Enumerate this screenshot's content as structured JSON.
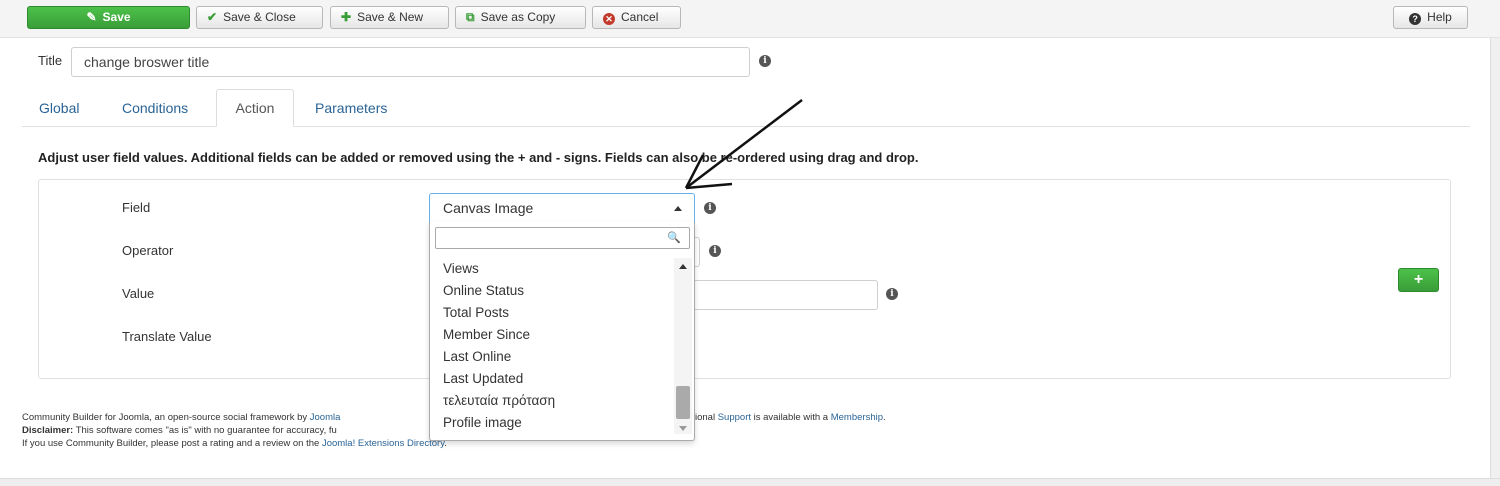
{
  "toolbar": {
    "save": "Save",
    "save_close": "Save & Close",
    "save_new": "Save & New",
    "save_copy": "Save as Copy",
    "cancel": "Cancel",
    "help": "Help"
  },
  "title": {
    "label": "Title",
    "value": "change broswer title"
  },
  "tabs": [
    "Global",
    "Conditions",
    "Action",
    "Parameters"
  ],
  "description": "Adjust user field values. Additional fields can be added or removed using the + and - signs. Fields can also be re-ordered using drag and drop.",
  "form": {
    "field_label": "Field",
    "operator_label": "Operator",
    "value_label": "Value",
    "translate_label": "Translate Value",
    "field_selected": "Canvas Image"
  },
  "dropdown": {
    "items": [
      "Views",
      "Online Status",
      "Total Posts",
      "Member Since",
      "Last Online",
      "Last Updated",
      "τελευταία πρόταση",
      "Profile image"
    ]
  },
  "footer": {
    "line1_prefix": "Community Builder for Joomla, an open-source social framework by ",
    "line1_link": "Joomla",
    "line1_right_prefix": "ional ",
    "line1_right_link1": "Support",
    "line1_right_mid": " is available with a ",
    "line1_right_link2": "Membership",
    "line1_right_end": ".",
    "disclaimer_label": "Disclaimer:",
    "disclaimer_text": " This software comes \"as is\" with no guarantee for accuracy, fu",
    "line3_prefix": "If you use Community Builder, please post a rating and a review on the ",
    "line3_link": "Joomla! Extensions Directory",
    "line3_end": "."
  },
  "colors": {
    "primary_green": "#3a9d38",
    "link_blue": "#2a6496",
    "cancel_red": "#c23a2b"
  }
}
